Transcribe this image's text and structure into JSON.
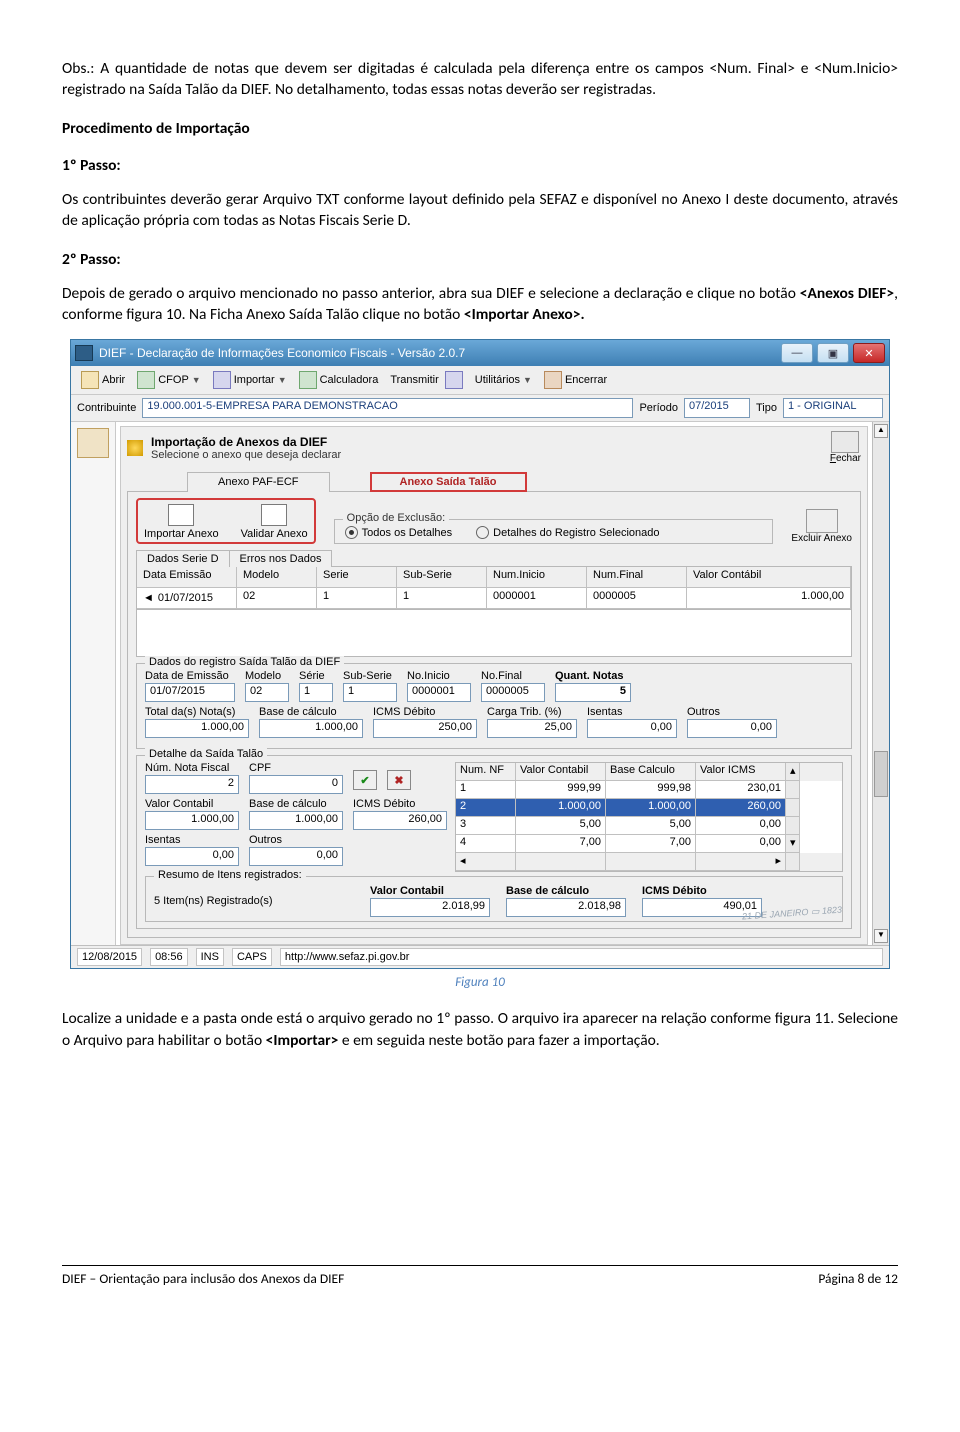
{
  "doc": {
    "p1": "Obs.: A quantidade de notas que devem ser digitadas é calculada pela diferença entre os campos <Num. Final> e <Num.Inicio> registrado na Saída Talão da DIEF. No detalhamento, todas essas notas deverão ser registradas.",
    "h1": "Procedimento de Importação",
    "s1": "1º Passo:",
    "p2": "Os contribuintes deverão gerar Arquivo TXT conforme layout definido pela SEFAZ e disponível no Anexo I deste documento, através de aplicação própria com todas as Notas Fiscais Serie D.",
    "s2": "2º Passo:",
    "p3a": "Depois de gerado o arquivo mencionado no passo anterior, abra sua DIEF e selecione a declaração e clique no botão ",
    "p3b": "<Anexos DIEF>",
    "p3c": ", conforme figura 10. Na Ficha Anexo Saída Talão clique no botão ",
    "p3d": "<Importar Anexo>.",
    "caption": "Figura 10",
    "p4a": "Localize a unidade e a pasta onde está o arquivo gerado no 1º passo. O arquivo ira aparecer na relação conforme figura 11. Selecione o Arquivo para habilitar o botão ",
    "p4b": "<Importar>",
    "p4c": " e em seguida neste botão para fazer a importação.",
    "footer_left": "DIEF – Orientação para inclusão dos Anexos da DIEF",
    "footer_right": "Página 8 de 12"
  },
  "app": {
    "title": "DIEF - Declaração de Informações Economico Fiscais - Versão 2.0.7",
    "toolbar": {
      "abrir": "Abrir",
      "cfop": "CFOP",
      "importar": "Importar",
      "calculadora": "Calculadora",
      "transmitir": "Transmitir",
      "utilitarios": "Utilitários",
      "encerrar": "Encerrar"
    },
    "row2": {
      "contrib_lbl": "Contribuinte",
      "contrib_val": "19.000.001-5-EMPRESA PARA DEMONSTRACAO",
      "periodo_lbl": "Período",
      "periodo_val": "07/2015",
      "tipo_lbl": "Tipo",
      "tipo_val": "1 - ORIGINAL"
    },
    "hdr": {
      "title": "Importação de Anexos da DIEF",
      "sub": "Selecione o anexo que deseja declarar",
      "fechar": "Fechar"
    },
    "tabs": {
      "paf": "Anexo PAF-ECF",
      "saida": "Anexo Saída Talão"
    },
    "actions": {
      "importar": "Importar Anexo",
      "validar": "Validar Anexo",
      "excluir": "Excluir Anexo"
    },
    "excl": {
      "legend": "Opção de Exclusão:",
      "opt1": "Todos os Detalhes",
      "opt2": "Detalhes do Registro Selecionado"
    },
    "subtabs": {
      "dados": "Dados Serie D",
      "erros": "Erros nos Dados"
    },
    "grid": {
      "h": [
        "Data Emissão",
        "Modelo",
        "Serie",
        "Sub-Serie",
        "Num.Inicio",
        "Num.Final",
        "Valor Contábil"
      ],
      "r": [
        "01/07/2015",
        "02",
        "1",
        "1",
        "0000001",
        "0000005",
        "1.000,00"
      ]
    },
    "fs1": {
      "legend": "Dados do registro Saída Talão da DIEF",
      "labels": [
        "Data de Emissão",
        "Modelo",
        "Série",
        "Sub-Serie",
        "No.Inicio",
        "No.Final",
        "Quant. Notas"
      ],
      "vals": [
        "01/07/2015",
        "02",
        "1",
        "1",
        "0000001",
        "0000005",
        "5"
      ],
      "labels2": [
        "Total da(s) Nota(s)",
        "Base de cálculo",
        "ICMS  Débito",
        "Carga Trib. (%)",
        "Isentas",
        "Outros"
      ],
      "vals2": [
        "1.000,00",
        "1.000,00",
        "250,00",
        "25,00",
        "0,00",
        "0,00"
      ]
    },
    "fs2": {
      "legend": "Detalhe da Saída Talão",
      "labels": [
        "Núm. Nota Fiscal",
        "CPF"
      ],
      "vals": [
        "2",
        "0"
      ],
      "labels2": [
        "Valor Contabil",
        "Base de cálculo",
        "ICMS  Débito"
      ],
      "vals2": [
        "1.000,00",
        "1.000,00",
        "260,00"
      ],
      "labels3": [
        "Isentas",
        "Outros"
      ],
      "vals3": [
        "0,00",
        "0,00"
      ],
      "th": [
        "Num. NF",
        "Valor Contabil",
        "Base Calculo",
        "Valor ICMS"
      ],
      "rows": [
        [
          "1",
          "999,99",
          "999,98",
          "230,01"
        ],
        [
          "2",
          "1.000,00",
          "1.000,00",
          "260,00"
        ],
        [
          "3",
          "5,00",
          "5,00",
          "0,00"
        ],
        [
          "4",
          "7,00",
          "7,00",
          "0,00"
        ]
      ]
    },
    "sum": {
      "legend": "Resumo de Itens registrados:",
      "items": "5 Item(ns) Registrado(s)",
      "h": [
        "Valor Contabil",
        "Base de cálculo",
        "ICMS  Débito"
      ],
      "v": [
        "2.018,99",
        "2.018,98",
        "490,01"
      ]
    },
    "status": {
      "date": "12/08/2015",
      "time": "08:56",
      "ins": "INS",
      "caps": "CAPS",
      "url": "http://www.sefaz.pi.gov.br"
    }
  }
}
